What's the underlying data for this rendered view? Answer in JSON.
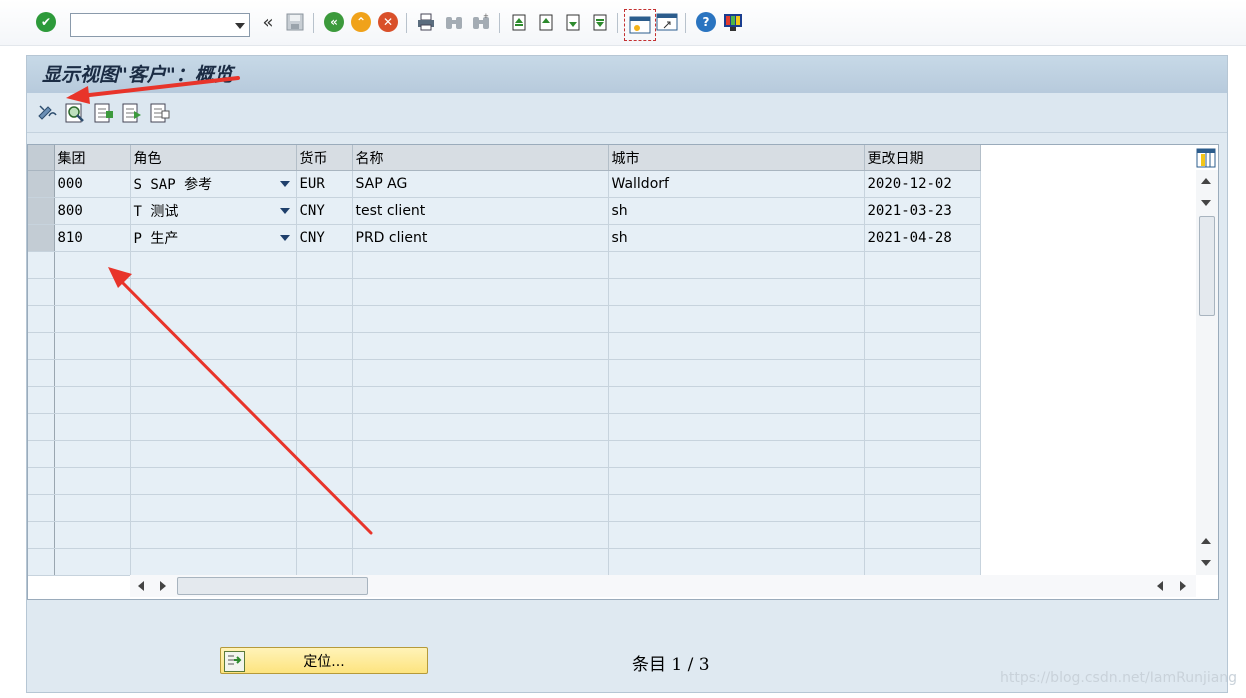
{
  "page_title": "显示视图\"客户\"：概览",
  "command_field": {
    "value": ""
  },
  "toolbar_icons": [
    "enter-check-icon",
    "command-dropdown-icon",
    "collapse-left-icon",
    "save-icon",
    "back-icon",
    "exit-icon",
    "cancel-icon",
    "print-icon",
    "find-icon",
    "find-next-icon",
    "first-page-icon",
    "previous-page-icon",
    "next-page-icon",
    "last-page-icon",
    "new-session-icon",
    "shortcut-icon",
    "help-icon",
    "customize-layout-icon"
  ],
  "table": {
    "columns": [
      "集团",
      "角色",
      "货币",
      "名称",
      "城市",
      "更改日期"
    ],
    "rows": [
      {
        "client": "000",
        "role": "S SAP 参考",
        "currency": "EUR",
        "name": "SAP AG",
        "city": "Walldorf",
        "changed": "2020-12-02"
      },
      {
        "client": "800",
        "role": "T 测试",
        "currency": "CNY",
        "name": "test client",
        "city": "sh",
        "changed": "2021-03-23"
      },
      {
        "client": "810",
        "role": "P 生产",
        "currency": "CNY",
        "name": "PRD client",
        "city": "sh",
        "changed": "2021-04-28"
      }
    ],
    "empty_rows": 12
  },
  "locate_button": "定位...",
  "entry_counter": "条目 1 / 3",
  "watermark": "https://blog.csdn.net/IamRunjiang",
  "colors": {
    "annotation_arrow": "#e8342a",
    "title_bar": "#b7cadc",
    "locate_button": "#fde47f"
  }
}
